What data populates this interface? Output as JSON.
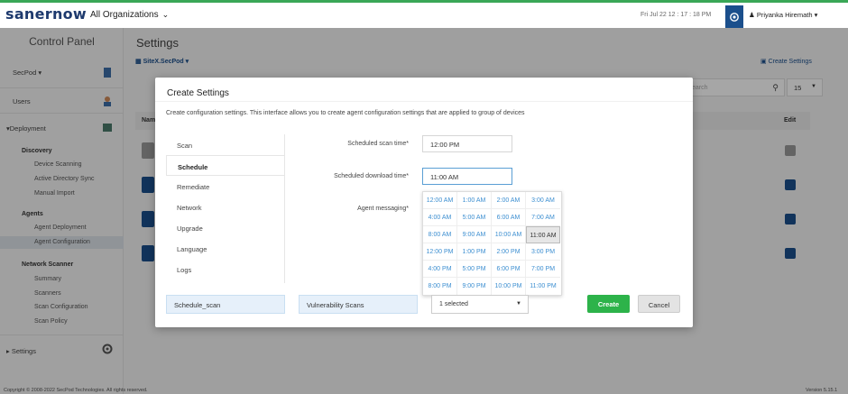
{
  "header": {
    "logo": "sanernow",
    "org_selector": "All Organizations",
    "datetime": "Fri Jul 22  12 : 17 : 18 PM",
    "user": "Priyanka Hiremath"
  },
  "sidebar": {
    "title": "Control Panel",
    "secpod": "SecPod",
    "users": "Users",
    "deployment": "Deployment",
    "discovery": "Discovery",
    "device_scanning": "Device Scanning",
    "ad_sync": "Active Directory Sync",
    "manual_import": "Manual Import",
    "agents": "Agents",
    "agent_deployment": "Agent Deployment",
    "agent_configuration": "Agent Configuration",
    "network_scanner": "Network Scanner",
    "summary": "Summary",
    "scanners": "Scanners",
    "scan_configuration": "Scan Configuration",
    "scan_policy": "Scan Policy",
    "settings": "Settings"
  },
  "main": {
    "title": "Settings",
    "site": "SiteX.SecPod",
    "create_settings": "Create Settings",
    "search_placeholder": "earch",
    "page_size": "15",
    "col_name": "Nam",
    "col_edit": "Edit"
  },
  "footer": {
    "copyright": "Copyright © 2008-2022 SecPod Technologies. All rights reserved.",
    "version": "Version 5.15.1"
  },
  "modal": {
    "title": "Create Settings",
    "description": "Create configuration settings. This interface allows you to create agent configuration settings that are applied to group of devices",
    "tabs": [
      "Scan",
      "Schedule",
      "Remediate",
      "Network",
      "Upgrade",
      "Language",
      "Logs"
    ],
    "active_tab": "Schedule",
    "scan_time_label": "Scheduled scan time*",
    "scan_time_value": "12:00 PM",
    "download_time_label": "Scheduled download time*",
    "download_time_value": "11:00 AM",
    "messaging_label": "Agent messaging*",
    "time_options": [
      [
        "12:00 AM",
        "1:00 AM",
        "2:00 AM",
        "3:00 AM"
      ],
      [
        "4:00 AM",
        "5:00 AM",
        "6:00 AM",
        "7:00 AM"
      ],
      [
        "8:00 AM",
        "9:00 AM",
        "10:00 AM",
        "11:00 AM"
      ],
      [
        "12:00 PM",
        "1:00 PM",
        "2:00 PM",
        "3:00 PM"
      ],
      [
        "4:00 PM",
        "5:00 PM",
        "6:00 PM",
        "7:00 PM"
      ],
      [
        "8:00 PM",
        "9:00 PM",
        "10:00 PM",
        "11:00 PM"
      ]
    ],
    "selected_time": "11:00 AM",
    "setting_name": "Schedule_scan",
    "setting_type": "Vulnerability Scans",
    "groups_select": "1 selected",
    "create_button": "Create",
    "cancel_button": "Cancel"
  },
  "colors": {
    "brand": "#1e3a6e",
    "accent": "#1b4f8c",
    "create_green": "#2db34a",
    "top_border": "#3aa757"
  }
}
